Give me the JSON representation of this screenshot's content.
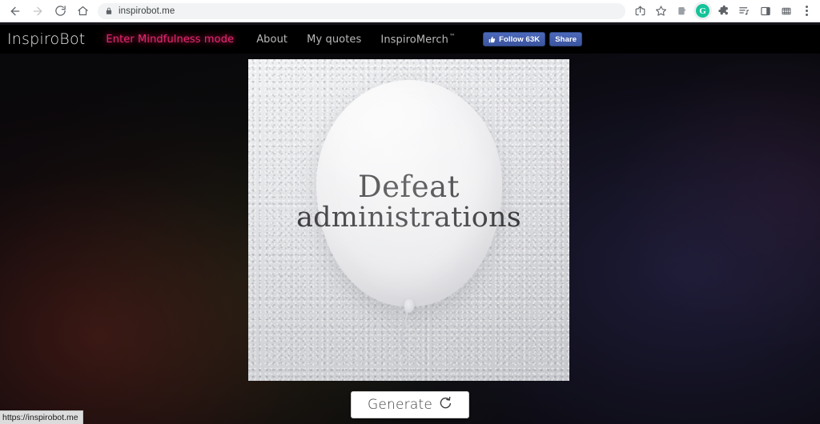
{
  "browser": {
    "url": "inspirobot.me",
    "status_url": "https://inspirobot.me",
    "nav": {
      "back": "back-arrow-icon",
      "forward": "forward-arrow-icon",
      "reload": "reload-icon",
      "home": "home-icon"
    },
    "omnibox": {
      "lock": "lock-icon"
    },
    "toolbar_icons": [
      "share-icon",
      "bookmark-star-icon",
      "extension-puzzle-dark-icon",
      "grammarly-icon",
      "puzzle-extensions-icon",
      "reading-list-icon",
      "side-panel-icon",
      "grid-extension-icon",
      "kebab-menu-icon"
    ],
    "grammarly_letter": "G"
  },
  "site": {
    "brand": "InspiroBot",
    "nav_links": [
      {
        "label": "Enter Mindfulness mode",
        "kind": "mindfulness"
      },
      {
        "label": "About",
        "kind": "normal"
      },
      {
        "label": "My quotes",
        "kind": "normal"
      },
      {
        "label": "InspiroMerch",
        "kind": "trademark",
        "tm": "™"
      }
    ],
    "social": {
      "follow_label": "Follow 63K",
      "share_label": "Share",
      "thumb_icon": "thumbs-up-icon"
    },
    "colors": {
      "mindfulness_pink": "#e8286f",
      "facebook_blue": "#4c69ba",
      "nav_background": "#000000",
      "page_background": "#09080b"
    }
  },
  "poster": {
    "quote_line_1": "Defeat",
    "quote_line_2": "administrations",
    "alt": "white balloon on textured wall with quote"
  },
  "generate": {
    "label": "Generate",
    "icon": "refresh-icon"
  }
}
